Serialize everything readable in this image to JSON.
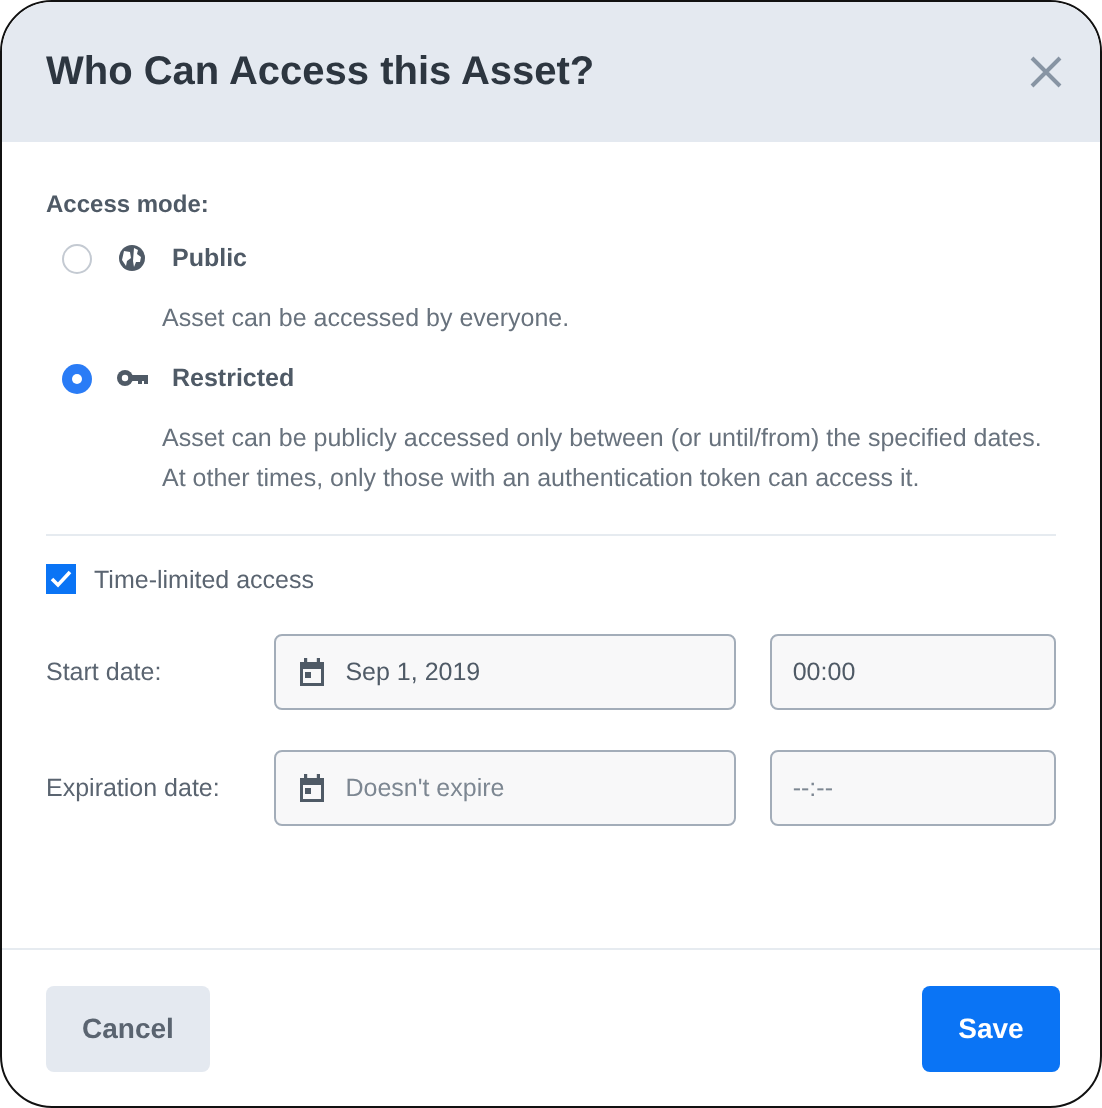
{
  "dialog": {
    "title": "Who Can Access this Asset?"
  },
  "access_mode": {
    "label": "Access mode:",
    "options": [
      {
        "label": "Public",
        "kind": "globe",
        "selected": false,
        "description": "Asset can be accessed by everyone."
      },
      {
        "label": "Restricted",
        "kind": "key",
        "selected": true,
        "description": "Asset can be publicly accessed only between (or until/from) the specified dates. At other times, only those with an authentication token can access it."
      }
    ]
  },
  "time_limited": {
    "label": "Time-limited access",
    "checked": true
  },
  "dates": [
    {
      "label": "Start date:",
      "date": {
        "value": "Sep 1, 2019"
      },
      "time": {
        "value": "00:00"
      }
    },
    {
      "label": "Expiration date:",
      "date": {
        "placeholder": "Doesn't expire"
      },
      "time": {
        "placeholder": "--:--"
      }
    }
  ],
  "buttons": [
    {
      "label": "Cancel",
      "kind": "secondary"
    },
    {
      "label": "Save",
      "kind": "primary"
    }
  ]
}
